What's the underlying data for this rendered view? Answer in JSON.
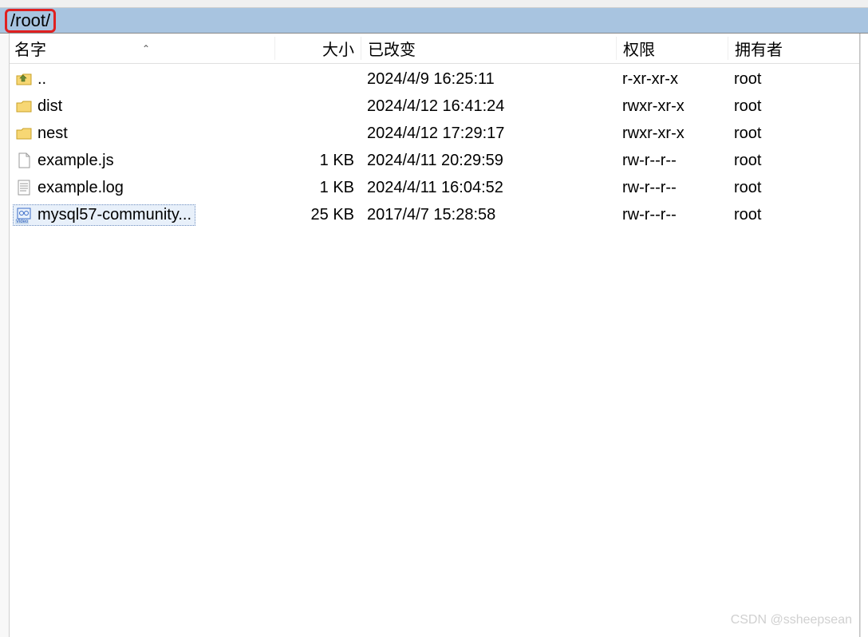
{
  "path": "/root/",
  "columns": {
    "name": "名字",
    "size": "大小",
    "modified": "已改变",
    "permissions": "权限",
    "owner": "拥有者"
  },
  "files": [
    {
      "name": "..",
      "size": "",
      "modified": "2024/4/9 16:25:11",
      "permissions": "r-xr-xr-x",
      "owner": "root",
      "type": "parent"
    },
    {
      "name": "dist",
      "size": "",
      "modified": "2024/4/12 16:41:24",
      "permissions": "rwxr-xr-x",
      "owner": "root",
      "type": "folder"
    },
    {
      "name": "nest",
      "size": "",
      "modified": "2024/4/12 17:29:17",
      "permissions": "rwxr-xr-x",
      "owner": "root",
      "type": "folder"
    },
    {
      "name": "example.js",
      "size": "1 KB",
      "modified": "2024/4/11 20:29:59",
      "permissions": "rw-r--r--",
      "owner": "root",
      "type": "file"
    },
    {
      "name": "example.log",
      "size": "1 KB",
      "modified": "2024/4/11 16:04:52",
      "permissions": "rw-r--r--",
      "owner": "root",
      "type": "log"
    },
    {
      "name": "mysql57-community...",
      "size": "25 KB",
      "modified": "2017/4/7 15:28:58",
      "permissions": "rw-r--r--",
      "owner": "root",
      "type": "video",
      "selected": true
    }
  ],
  "watermark": "CSDN @ssheepsean"
}
